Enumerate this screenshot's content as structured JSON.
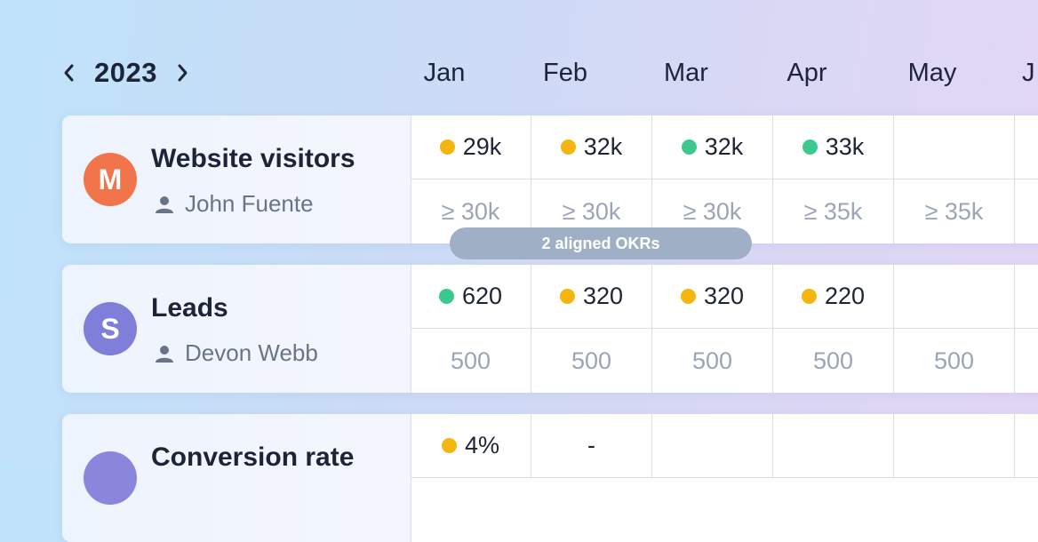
{
  "header": {
    "year": "2023",
    "prev_icon": "chevron-left-icon",
    "next_icon": "chevron-right-icon",
    "months": [
      "Jan",
      "Feb",
      "Mar",
      "Apr",
      "May",
      "J"
    ]
  },
  "okrs": [
    {
      "avatar_letter": "M",
      "avatar_color": "#f2744b",
      "title": "Website visitors",
      "owner": "John Fuente",
      "actuals": [
        {
          "value": "29k",
          "status": "yellow"
        },
        {
          "value": "32k",
          "status": "yellow"
        },
        {
          "value": "32k",
          "status": "green"
        },
        {
          "value": "33k",
          "status": "green"
        },
        {
          "value": "",
          "status": ""
        }
      ],
      "targets": [
        "≥ 30k",
        "≥ 30k",
        "≥ 30k",
        "≥ 35k",
        "≥ 35k"
      ]
    },
    {
      "avatar_letter": "S",
      "avatar_color": "#7f7ed9",
      "title": "Leads",
      "owner": "Devon Webb",
      "actuals": [
        {
          "value": "620",
          "status": "green"
        },
        {
          "value": "320",
          "status": "yellow"
        },
        {
          "value": "320",
          "status": "yellow"
        },
        {
          "value": "220",
          "status": "yellow"
        },
        {
          "value": "",
          "status": ""
        }
      ],
      "targets": [
        "500",
        "500",
        "500",
        "500",
        "500"
      ]
    },
    {
      "avatar_letter": "",
      "avatar_color": "#8a86dc",
      "title": "Conversion rate",
      "actuals": [
        {
          "value": "4%",
          "status": "yellow"
        },
        {
          "value": "-",
          "status": ""
        },
        {
          "value": "",
          "status": ""
        },
        {
          "value": "",
          "status": ""
        },
        {
          "value": "",
          "status": ""
        }
      ]
    }
  ],
  "aligned_pill": "2 aligned OKRs",
  "colors": {
    "status_yellow": "#f6b40e",
    "status_green": "#3cc98e",
    "pill_bg": "#9fb0c6"
  }
}
